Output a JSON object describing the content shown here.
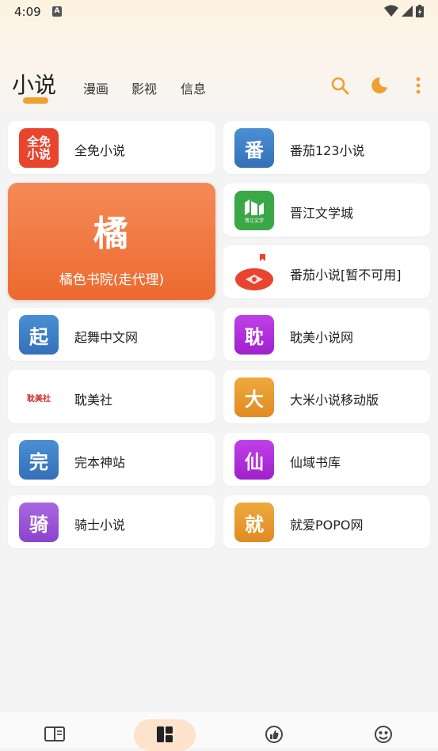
{
  "status": {
    "time": "4:09",
    "notif_letter": "A"
  },
  "header": {
    "tabs": [
      {
        "label": "小说",
        "active": true
      },
      {
        "label": "漫画"
      },
      {
        "label": "影视"
      },
      {
        "label": "信息"
      }
    ],
    "icons": [
      "search-icon",
      "moon-icon",
      "more-vert-icon"
    ]
  },
  "colors": {
    "accent": "#f0a030",
    "feature_top": "#f58a56",
    "feature_bottom": "#ec6a30"
  },
  "featured": {
    "logo_char": "橘",
    "label": "橘色书院(走代理)"
  },
  "left_sites": [
    {
      "label": "全免小说",
      "logo_text": "全免小说",
      "logo_color": "#e8442e"
    },
    {
      "label": "起舞中文网",
      "logo_text": "起",
      "logo_color": "#3d7fc6"
    },
    {
      "label": "耽美社",
      "logo_text": "耽美社",
      "logo_color": "#ffffff"
    },
    {
      "label": "完本神站",
      "logo_text": "完",
      "logo_color": "#3d7fc6"
    },
    {
      "label": "骑士小说",
      "logo_text": "骑",
      "logo_color": "#9a55d6"
    }
  ],
  "right_sites": [
    {
      "label": "番茄123小说",
      "logo_text": "番",
      "logo_color": "#3d7fc6"
    },
    {
      "label": "晋江文学城",
      "logo_text": "晋江文学",
      "logo_color": "#3aa847"
    },
    {
      "label": "番茄小说[暂不可用]",
      "logo_text": "",
      "logo_color": "#e8442e"
    },
    {
      "label": "耽美小说网",
      "logo_text": "耽",
      "logo_color": "#b030d8"
    },
    {
      "label": "大米小说移动版",
      "logo_text": "大",
      "logo_color": "#e69a2e"
    },
    {
      "label": "仙域书库",
      "logo_text": "仙",
      "logo_color": "#b030d8"
    },
    {
      "label": "就爱POPO网",
      "logo_text": "就",
      "logo_color": "#e69a2e"
    }
  ],
  "bottom_nav": [
    {
      "icon": "book-icon",
      "active": false
    },
    {
      "icon": "dashboard-icon",
      "active": true
    },
    {
      "icon": "thumb-up-icon",
      "active": false
    },
    {
      "icon": "mood-icon",
      "active": false
    }
  ]
}
